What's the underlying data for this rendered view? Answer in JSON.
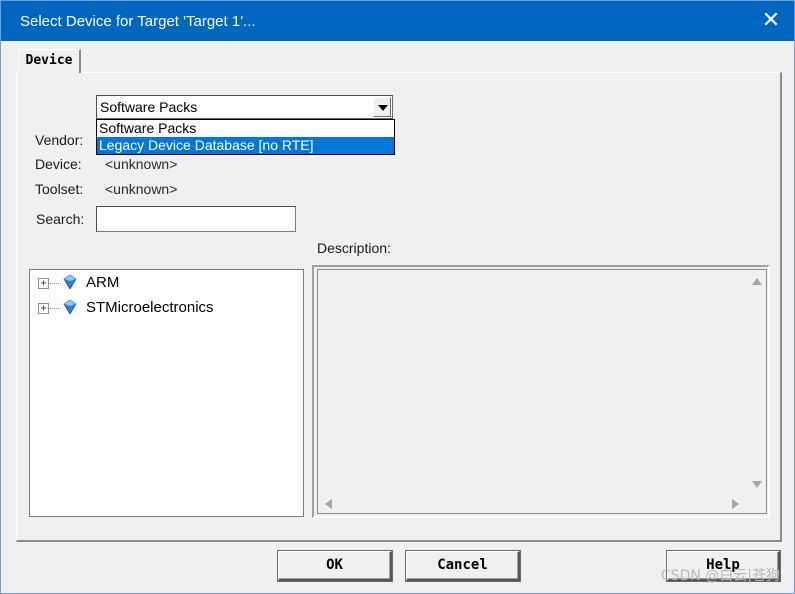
{
  "window": {
    "title": "Select Device for Target 'Target 1'...",
    "close_glyph": "✕",
    "accent_color": "#0067c0"
  },
  "tabs": [
    {
      "label": "Device",
      "active": true
    }
  ],
  "form": {
    "vendor_label": "Vendor:",
    "device_label": "Device:",
    "device_value": "<unknown>",
    "toolset_label": "Toolset:",
    "toolset_value": "<unknown>",
    "search_label": "Search:",
    "search_value": ""
  },
  "database_select": {
    "selected": "Software Packs",
    "options": [
      "Software Packs",
      "Legacy Device Database [no RTE]"
    ],
    "highlighted_option": "Legacy Device Database [no RTE]",
    "highlight_color": "#0078d7"
  },
  "tree": {
    "items": [
      {
        "label": "ARM",
        "icon": "gem-icon",
        "expander": "+"
      },
      {
        "label": "STMicroelectronics",
        "icon": "gem-icon",
        "expander": "+"
      }
    ]
  },
  "description": {
    "label": "Description:",
    "text": ""
  },
  "buttons": {
    "ok": "OK",
    "cancel": "Cancel",
    "help": "Help"
  },
  "watermark": "CSDN @白云|苍狗"
}
